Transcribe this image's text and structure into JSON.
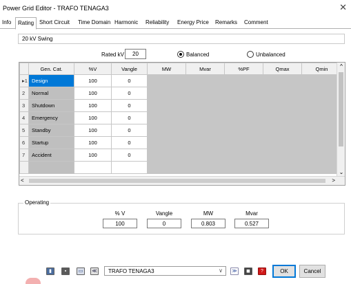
{
  "window": {
    "title": "Power Grid Editor - TRAFO TENAGA3",
    "close_glyph": "✕"
  },
  "tabs": [
    {
      "label": "Info",
      "active": false
    },
    {
      "label": "Rating",
      "active": true
    },
    {
      "label": "Short Circuit",
      "active": false
    },
    {
      "label": "Time Domain",
      "active": false
    },
    {
      "label": "Harmonic",
      "active": false
    },
    {
      "label": "Reliability",
      "active": false
    },
    {
      "label": "Energy Price",
      "active": false
    },
    {
      "label": "Remarks",
      "active": false
    },
    {
      "label": "Comment",
      "active": false
    }
  ],
  "bus_name": "20 kV  Swing",
  "rating": {
    "rated_kv_label": "Rated kV",
    "rated_kv_value": "20",
    "balanced_label": "Balanced",
    "unbalanced_label": "Unbalanced",
    "balanced_checked": true
  },
  "grid": {
    "columns": [
      "Gen. Cat.",
      "%V",
      "Vangle",
      "MW",
      "Mvar",
      "%PF",
      "Qmax",
      "Qmin"
    ],
    "rows": [
      {
        "marker": "▸1",
        "category": "Design",
        "v": "100",
        "vangle": "0",
        "selected": true
      },
      {
        "marker": "2",
        "category": "Normal",
        "v": "100",
        "vangle": "0",
        "selected": false
      },
      {
        "marker": "3",
        "category": "Shutdown",
        "v": "100",
        "vangle": "0",
        "selected": false
      },
      {
        "marker": "4",
        "category": "Emergency",
        "v": "100",
        "vangle": "0",
        "selected": false
      },
      {
        "marker": "5",
        "category": "Standby",
        "v": "100",
        "vangle": "0",
        "selected": false
      },
      {
        "marker": "6",
        "category": "Startup",
        "v": "100",
        "vangle": "0",
        "selected": false
      },
      {
        "marker": "7",
        "category": "Accident",
        "v": "100",
        "vangle": "0",
        "selected": false
      }
    ],
    "scroll_up": "^",
    "scroll_down": "⌄",
    "scroll_left": "<",
    "scroll_right": ">"
  },
  "operating": {
    "label": "Operating",
    "headers": [
      "% V",
      "Vangle",
      "MW",
      "Mvar"
    ],
    "values": [
      "100",
      "0",
      "0.803",
      "0.527"
    ]
  },
  "footer": {
    "icons": [
      "first-record-icon",
      "save-icon",
      "print-icon",
      "previous-icon",
      "next-icon",
      "find-icon",
      "help-icon"
    ],
    "combo_value": "TRAFO TENAGA3",
    "combo_arrow": "∨",
    "ok_label": "OK",
    "cancel_label": "Cancel"
  }
}
